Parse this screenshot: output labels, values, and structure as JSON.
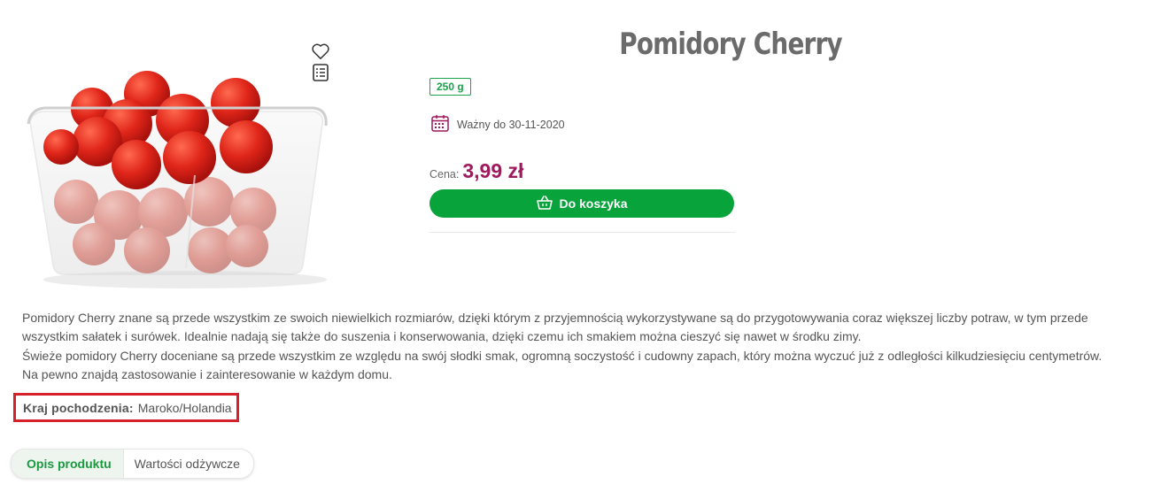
{
  "product": {
    "title": "Pomidory Cherry",
    "weight": "250 g",
    "validity": "Ważny do 30-11-2020",
    "price_label": "Cena:",
    "price_value": "3,99 zł",
    "cart_button": "Do koszyka"
  },
  "description": {
    "paragraphs": [
      "Pomidory Cherry znane są przede wszystkim ze swoich niewielkich rozmiarów, dzięki którym z przyjemnością wykorzystywane są do przygotowywania coraz większej liczby potraw, w tym przede wszystkim sałatek i surówek. Idealnie nadają się także do suszenia i konserwowania, dzięki czemu ich smakiem można cieszyć się nawet w środku zimy.",
      "Świeże pomidory Cherry doceniane są przede wszystkim ze względu na swój słodki smak, ogromną soczystość i cudowny zapach, który można wyczuć już z odległości kilkudziesięciu centymetrów.",
      "Na pewno znajdą zastosowanie i zainteresowanie w każdym domu."
    ]
  },
  "origin": {
    "label": "Kraj pochodzenia:",
    "value": "Maroko/Holandia"
  },
  "tabs": [
    {
      "label": "Opis produktu",
      "active": true
    },
    {
      "label": "Wartości odżywcze",
      "active": false
    }
  ],
  "colors": {
    "accent_green": "#08a33a",
    "price": "#a0185e",
    "highlight_red": "#d6202a"
  },
  "icons": {
    "favorite": "heart-icon",
    "list": "shopping-list-icon",
    "calendar": "calendar-icon",
    "basket": "basket-icon"
  }
}
